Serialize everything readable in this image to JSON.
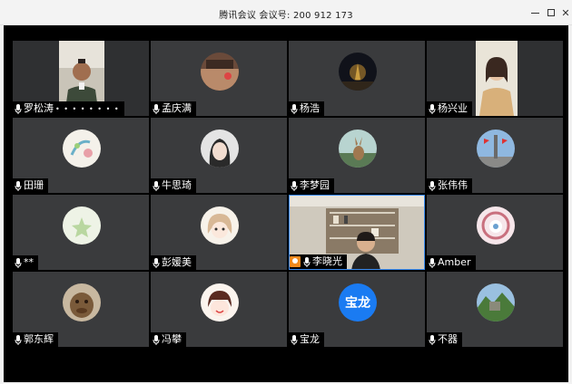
{
  "window": {
    "title": "腾讯会议  会议号: 200 912 173"
  },
  "participants": [
    {
      "name": "罗松涛",
      "extra": "• • • • • • • •",
      "kind": "video-portrait"
    },
    {
      "name": "孟庆满",
      "kind": "avatar"
    },
    {
      "name": "杨浩",
      "kind": "avatar"
    },
    {
      "name": "杨兴业",
      "kind": "video-portrait"
    },
    {
      "name": "田珊",
      "kind": "avatar"
    },
    {
      "name": "牛思琦",
      "kind": "avatar"
    },
    {
      "name": "李梦园",
      "kind": "avatar"
    },
    {
      "name": "张伟伟",
      "kind": "avatar"
    },
    {
      "name": "**",
      "kind": "avatar"
    },
    {
      "name": "彭媛美",
      "kind": "avatar"
    },
    {
      "name": "李晓光",
      "kind": "video-host"
    },
    {
      "name": "Amber",
      "kind": "avatar"
    },
    {
      "name": "郭东辉",
      "kind": "avatar"
    },
    {
      "name": "冯攀",
      "kind": "avatar"
    },
    {
      "name": "宝龙",
      "kind": "text-avatar",
      "avatar_text": "宝龙"
    },
    {
      "name": "不器",
      "kind": "avatar"
    }
  ],
  "colors": {
    "tile_bg": "#3a3b3d",
    "grid_bg": "#000000",
    "host_badge": "#f08a1e",
    "text_avatar": "#1a7bf2"
  }
}
